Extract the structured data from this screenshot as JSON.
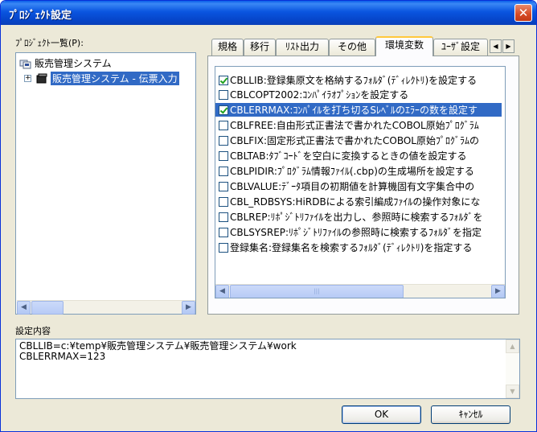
{
  "window": {
    "title": "ﾌﾟﾛｼﾞｪｸﾄ設定",
    "close_symbol": "✕",
    "colors": {
      "titlebar": "#0a55e0",
      "selection": "#316ac5",
      "face": "#ece9d8"
    }
  },
  "project_list": {
    "label": "ﾌﾟﾛｼﾞｪｸﾄ一覧(P):",
    "items": [
      {
        "text": "販売管理システム",
        "icon": "workspace-icon",
        "selected": false
      },
      {
        "text": "販売管理システム - 伝票入力",
        "icon": "project-icon",
        "selected": true,
        "expander": "+"
      }
    ]
  },
  "tabs": [
    {
      "label": "規格",
      "active": false
    },
    {
      "label": "移行",
      "active": false
    },
    {
      "label": "ﾘｽﾄ出力",
      "active": false
    },
    {
      "label": "その他",
      "active": false
    },
    {
      "label": "環境変数",
      "active": true
    },
    {
      "label": "ﾕｰｻﾞ設定",
      "active": false
    }
  ],
  "tab_scroll": {
    "left": "◀",
    "right": "▶"
  },
  "env_vars": [
    {
      "text": "CBLLIB:登録集原文を格納するﾌｫﾙﾀﾞ(ﾃﾞｨﾚｸﾄﾘ)を設定する",
      "checked": true,
      "highlight": false
    },
    {
      "text": "CBLCOPT2002:ｺﾝﾊﾟｲﾗｵﾌﾟｼｮﾝを設定する",
      "checked": false,
      "highlight": false
    },
    {
      "text": "CBLERRMAX:ｺﾝﾊﾟｲﾙを打ち切るSﾚﾍﾞﾙのｴﾗｰの数を設定す",
      "checked": true,
      "highlight": true
    },
    {
      "text": "CBLFREE:自由形式正書法で書かれたCOBOL原始ﾌﾟﾛｸﾞﾗﾑ",
      "checked": false,
      "highlight": false
    },
    {
      "text": "CBLFIX:固定形式正書法で書かれたCOBOL原始ﾌﾟﾛｸﾞﾗﾑの",
      "checked": false,
      "highlight": false
    },
    {
      "text": "CBLTAB:ﾀﾌﾞｺｰﾄﾞを空白に変換するときの値を設定する",
      "checked": false,
      "highlight": false
    },
    {
      "text": "CBLPIDIR:ﾌﾟﾛｸﾞﾗﾑ情報ﾌｧｲﾙ(.cbp)の生成場所を設定する",
      "checked": false,
      "highlight": false
    },
    {
      "text": "CBLVALUE:ﾃﾞｰﾀ項目の初期値を計算機固有文字集合中の",
      "checked": false,
      "highlight": false
    },
    {
      "text": "CBL_RDBSYS:HiRDBによる索引編成ﾌｧｲﾙの操作対象にな",
      "checked": false,
      "highlight": false
    },
    {
      "text": "CBLREP:ﾘﾎﾟｼﾞﾄﾘﾌｧｲﾙを出力し、参照時に検索するﾌｫﾙﾀﾞを",
      "checked": false,
      "highlight": false
    },
    {
      "text": "CBLSYSREP:ﾘﾎﾟｼﾞﾄﾘﾌｧｲﾙの参照時に検索するﾌｫﾙﾀﾞを指定",
      "checked": false,
      "highlight": false
    },
    {
      "text": "登録集名:登録集名を検索するﾌｫﾙﾀﾞ(ﾃﾞｨﾚｸﾄﾘ)を指定する",
      "checked": false,
      "highlight": false
    }
  ],
  "settings": {
    "label": "設定内容",
    "lines": [
      "CBLLIB=c:¥temp¥販売管理システム¥販売管理システム¥work",
      "CBLERRMAX=123"
    ]
  },
  "buttons": {
    "ok": "OK",
    "cancel": "ｷｬﾝｾﾙ"
  },
  "scroll": {
    "left": "◀",
    "right": "▶",
    "up": "▲",
    "down": "▼",
    "grip": "|||"
  }
}
